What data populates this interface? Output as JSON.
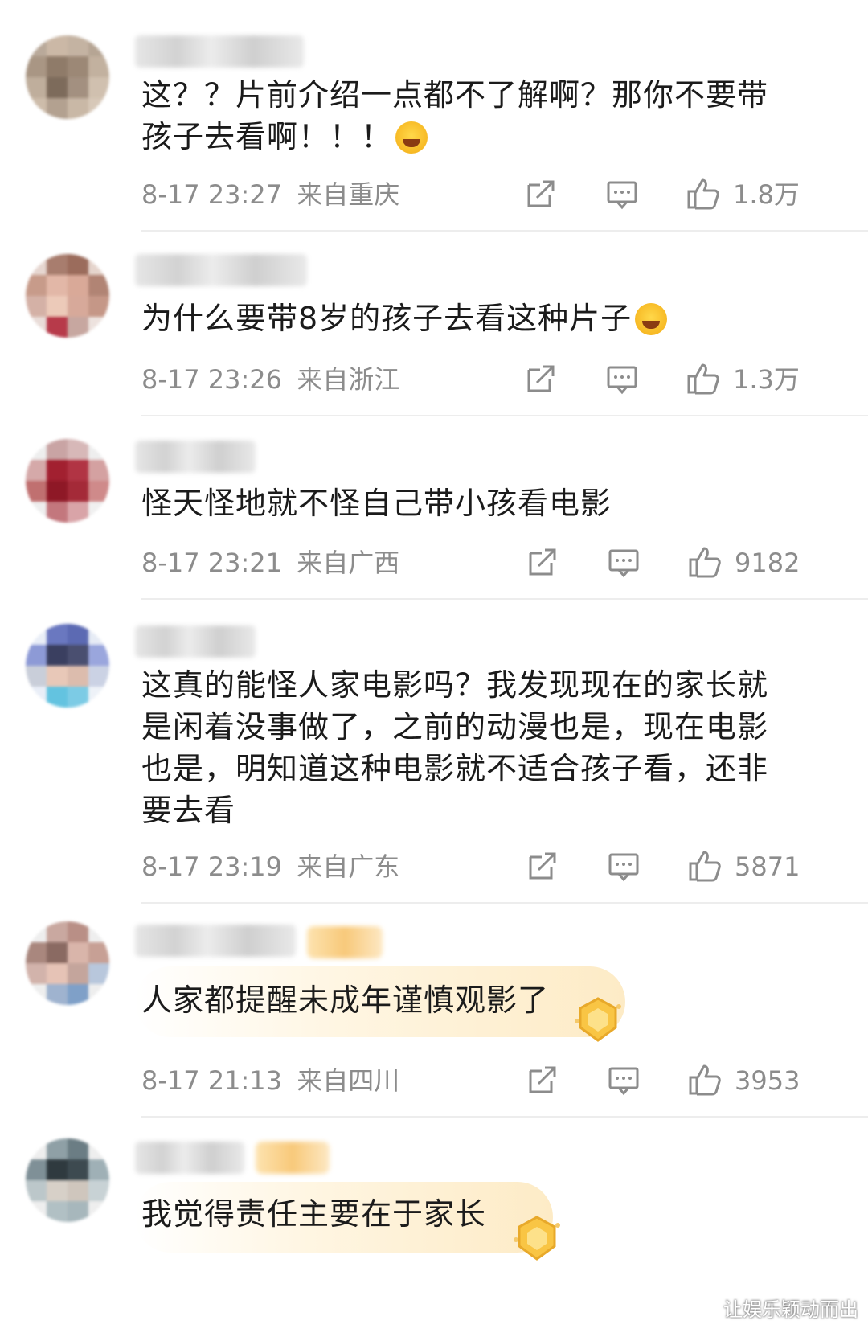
{
  "comments": [
    {
      "text_lines": [
        "这？？片前介绍一点都不了解啊？那你不要带",
        "孩子去看啊！！！"
      ],
      "emoji": "laugh-cry-emoji",
      "time": "8-17 23:27",
      "location": "来自重庆",
      "likes": "1.8万"
    },
    {
      "text_lines": [
        "为什么要带8岁的孩子去看这种片子"
      ],
      "emoji": "laugh-cry-emoji",
      "time": "8-17 23:26",
      "location": "来自浙江",
      "likes": "1.3万"
    },
    {
      "text_lines": [
        "怪天怪地就不怪自己带小孩看电影"
      ],
      "time": "8-17 23:21",
      "location": "来自广西",
      "likes": "9182"
    },
    {
      "text_lines": [
        "这真的能怪人家电影吗？我发现现在的家长就",
        "是闲着没事做了，之前的动漫也是，现在电影",
        "也是，明知道这种电影就不适合孩子看，还非",
        "要去看"
      ],
      "time": "8-17 23:19",
      "location": "来自广东",
      "likes": "5871"
    },
    {
      "text_lines": [
        "人家都提醒未成年谨慎观影了"
      ],
      "time": "8-17 21:13",
      "location": "来自四川",
      "likes": "3953"
    },
    {
      "text_lines": [
        "我觉得责任主要在于家长"
      ]
    }
  ],
  "watermark": "让娱乐颖动而出",
  "colors": {
    "meta_gray": "#8c8c8c",
    "divider": "#ededed",
    "badge_gold": "#f8c97a"
  }
}
